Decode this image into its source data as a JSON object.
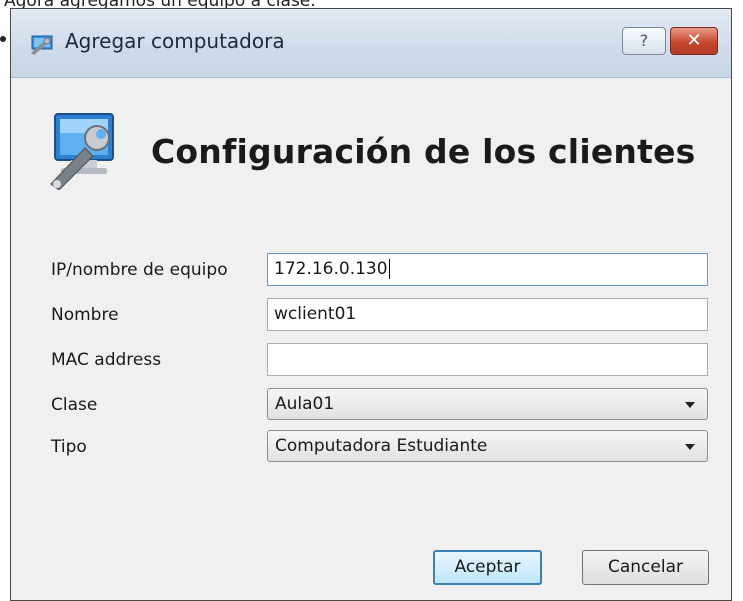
{
  "caption": "Agora agregamos un equipo a clase.",
  "window": {
    "title": "Agregar computadora",
    "help_button": "?",
    "close_button": "✕"
  },
  "header": {
    "title": "Configuración de los clientes",
    "icon": "computer-wrench-icon"
  },
  "form": {
    "ip_label": "IP/nombre de equipo",
    "ip_value": "172.16.0.130",
    "name_label": "Nombre",
    "name_value": "wclient01",
    "mac_label": "MAC address",
    "mac_value": "",
    "class_label": "Clase",
    "class_value": "Aula01",
    "type_label": "Tipo",
    "type_value": "Computadora Estudiante"
  },
  "buttons": {
    "accept": "Aceptar",
    "cancel": "Cancelar"
  }
}
